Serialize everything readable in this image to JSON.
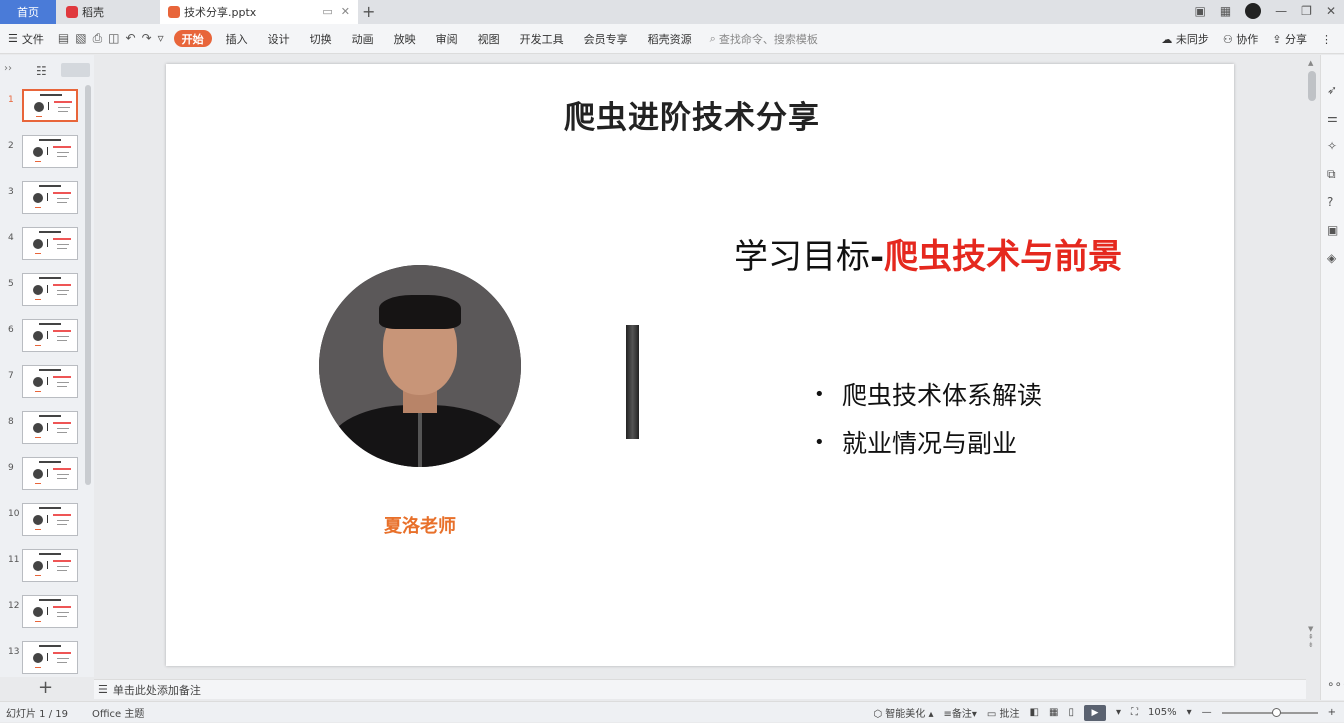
{
  "tabs": {
    "home": "首页",
    "daoke": "稻壳",
    "document": "技术分享.pptx",
    "add": "+"
  },
  "menu": {
    "file": "文件",
    "items": [
      "开始",
      "插入",
      "设计",
      "切换",
      "动画",
      "放映",
      "审阅",
      "视图",
      "开发工具",
      "会员专享",
      "稻壳资源"
    ],
    "search_placeholder": "查找命令、搜索模板",
    "sync": "未同步",
    "collaborate": "协作",
    "share": "分享"
  },
  "thumbnails": {
    "numbers": [
      "1",
      "2",
      "3",
      "4",
      "5",
      "6",
      "7",
      "8",
      "9",
      "10",
      "11",
      "12",
      "13"
    ],
    "active": "1"
  },
  "slide": {
    "title": "爬虫进阶技术分享",
    "goal_prefix": "学习目标",
    "goal_dash": "-",
    "goal_highlight": "爬虫技术与前景",
    "bullets": [
      "爬虫技术体系解读",
      "就业情况与副业"
    ],
    "teacher": "夏洛老师"
  },
  "notes": {
    "placeholder": "单击此处添加备注"
  },
  "status": {
    "slide_count": "幻灯片 1 / 19",
    "theme": "Office 主题",
    "smart_beautify": "智能美化",
    "notes": "备注",
    "comments": "批注",
    "zoom": "105%"
  },
  "colors": {
    "accent": "#e8653a",
    "home_tab": "#4a7bd8",
    "highlight_red": "#e5281e",
    "teacher_orange": "#e8702a"
  },
  "icons": [
    "search-icon",
    "cloud-sync-icon",
    "collaborate-icon",
    "share-icon",
    "play-icon",
    "zoom-fit-icon",
    "add-slide-icon"
  ]
}
